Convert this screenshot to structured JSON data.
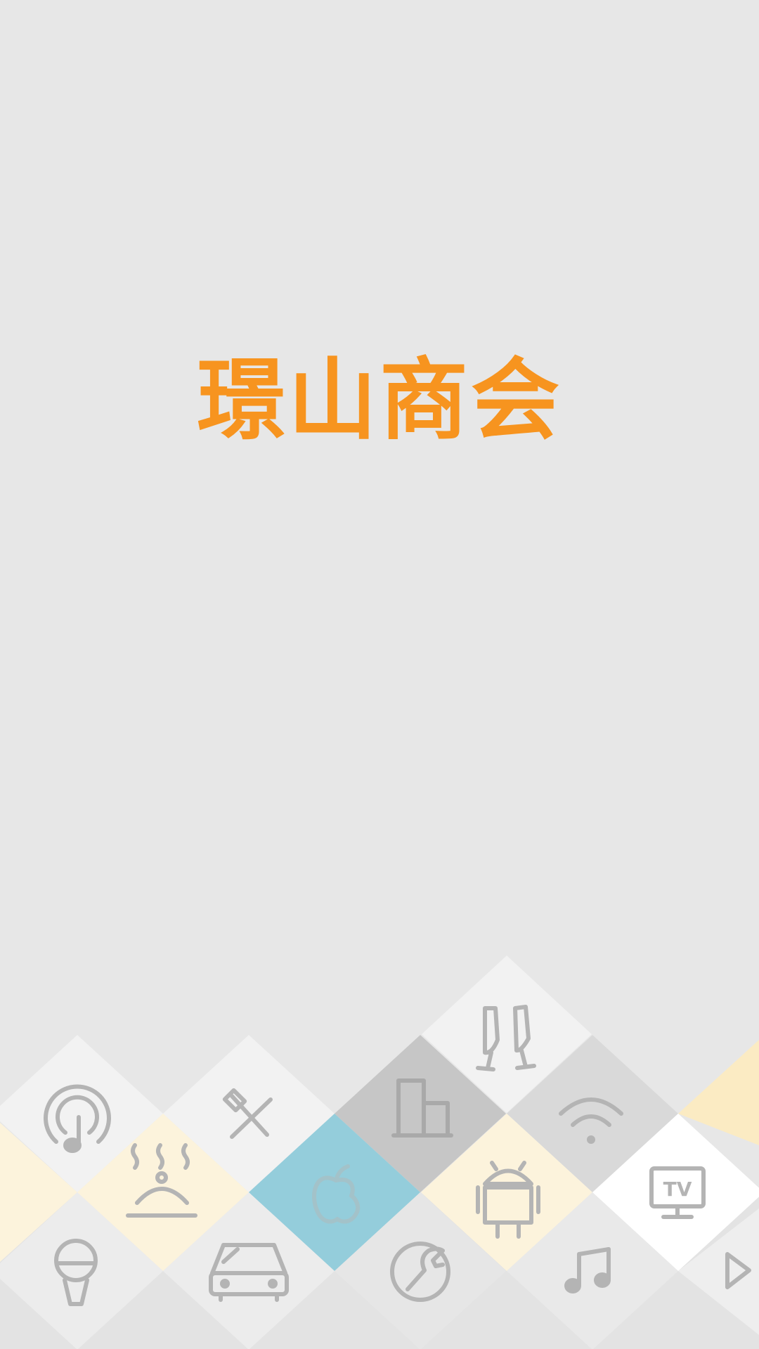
{
  "app": {
    "logo_text": "璟山商会"
  },
  "colors": {
    "background": "#e7e7e7",
    "brand_orange": "#f7941f",
    "tile_white": "#f2f2f2",
    "tile_light_gray": "#e2e2e2",
    "tile_mid_gray": "#d9d9d9",
    "tile_dark_gray": "#c6c6c6",
    "tile_blue": "#94cddb",
    "tile_pale_yellow": "#fcf3dc",
    "tile_yellow": "#fbebc3",
    "tile_bright_white": "#ffffff",
    "icon_stroke": "#b4b4b4"
  },
  "tiles": {
    "icons": [
      "music-podcast-icon",
      "tools-icon",
      "building-icon",
      "champagne-glasses-icon",
      "wifi-icon",
      "food-cloche-icon",
      "apple-icon",
      "android-icon",
      "tv-icon",
      "microphone-icon",
      "car-icon",
      "wrench-circle-icon",
      "music-note-icon",
      "play-icon"
    ],
    "tv_label": "TV"
  }
}
